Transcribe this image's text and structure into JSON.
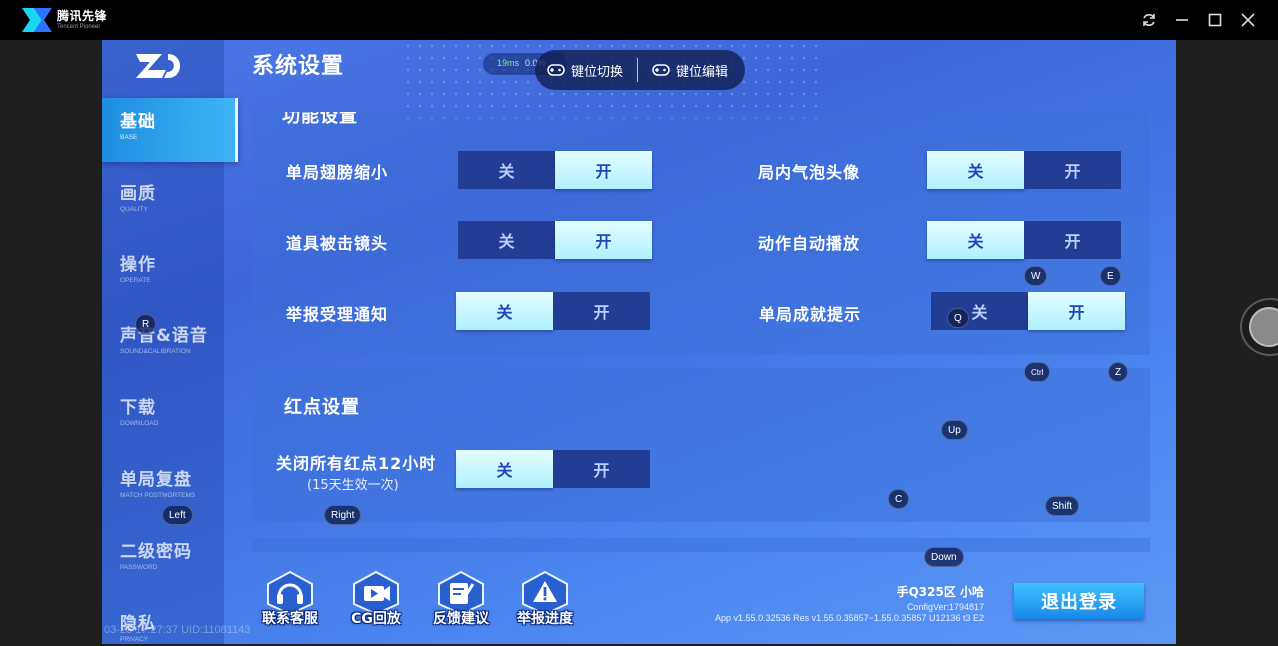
{
  "titlebar": {
    "brand_name": "腾讯先锋",
    "brand_sub": "Tencent Pioneer",
    "icons": [
      "refresh-icon",
      "minimize-icon",
      "maximize-icon",
      "close-icon"
    ]
  },
  "sidebar": {
    "items": [
      {
        "cn": "基础",
        "en": "BASE"
      },
      {
        "cn": "画质",
        "en": "QUALITY"
      },
      {
        "cn": "操作",
        "en": "OPERATE"
      },
      {
        "cn": "声音&语音",
        "en": "SOUND&CALIBRATION"
      },
      {
        "cn": "下载",
        "en": "DOWNLOAD"
      },
      {
        "cn": "单局复盘",
        "en": "MATCH POSTMORTEMS"
      },
      {
        "cn": "二级密码",
        "en": "PASSWORD"
      },
      {
        "cn": "隐私",
        "en": "PRIVACY"
      }
    ],
    "active_index": 0
  },
  "page_title": "系统设置",
  "ping": {
    "latency": "19ms",
    "loss": "0.0%"
  },
  "keybar": {
    "switch_label": "键位切换",
    "edit_label": "键位编辑"
  },
  "func_section": {
    "title": "功能设置",
    "rows": [
      {
        "label": "单局翅膀缩小",
        "off": "关",
        "on": "开",
        "state": "on"
      },
      {
        "label": "局内气泡头像",
        "off": "关",
        "on": "开",
        "state": "off"
      },
      {
        "label": "道具被击镜头",
        "off": "关",
        "on": "开",
        "state": "on"
      },
      {
        "label": "动作自动播放",
        "off": "关",
        "on": "开",
        "state": "off"
      },
      {
        "label": "举报受理通知",
        "off": "关",
        "on": "开",
        "state": "off"
      },
      {
        "label": "单局成就提示",
        "off": "关",
        "on": "开",
        "state": "on"
      }
    ]
  },
  "reddot_section": {
    "title": "红点设置",
    "row": {
      "label": "关闭所有红点12小时",
      "sub": "(15天生效一次)",
      "off": "关",
      "on": "开",
      "state": "off"
    }
  },
  "key_tags": [
    "W",
    "E",
    "R",
    "Q",
    "Ctrl",
    "Z",
    "Up",
    "C",
    "Shift",
    "Left",
    "Right",
    "Down"
  ],
  "tools": [
    {
      "label": "联系客服",
      "icon": "headset-icon"
    },
    {
      "label": "CG回放",
      "icon": "video-icon"
    },
    {
      "label": "反馈建议",
      "icon": "feedback-icon"
    },
    {
      "label": "举报进度",
      "icon": "warning-icon"
    }
  ],
  "account": {
    "name": "手Q325区 小哈",
    "config": "ConfigVer:1794817",
    "version": "App v1.55.0.32536 Res v1.55.0.35857−1.55.0.35857 U12136 t3 E2"
  },
  "logout_label": "退出登录",
  "uid_text": "03-23 17:27:37 UID:11081143",
  "colors": {
    "toggle_on": "#bff5ff",
    "toggle_off": "#223d94",
    "bg": "#4a7be8"
  }
}
